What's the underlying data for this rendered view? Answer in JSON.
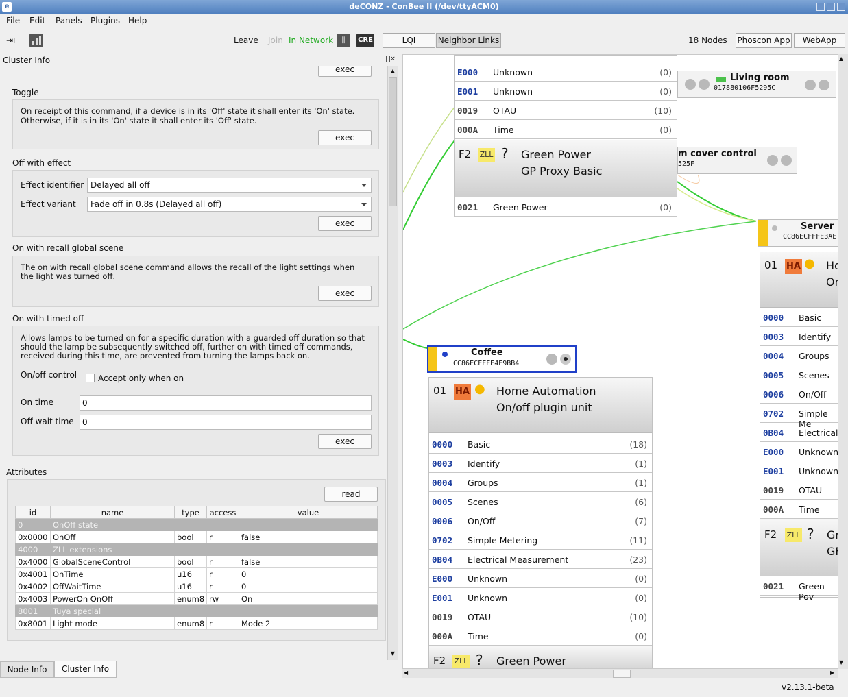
{
  "window": {
    "title": "deCONZ - ConBee II (/dev/ttyACM0)"
  },
  "menu": [
    "File",
    "Edit",
    "Panels",
    "Plugins",
    "Help"
  ],
  "toolbar": {
    "leave": "Leave",
    "join": "Join",
    "status": "In Network",
    "cre": "CRE",
    "lqi": "LQI",
    "neighbor_links": "Neighbor Links",
    "nodes": "18 Nodes",
    "phoscon": "Phoscon App",
    "webapp": "WebApp"
  },
  "panel": {
    "title": "Cluster Info"
  },
  "commands": {
    "exec": "exec",
    "toggle": {
      "title": "Toggle",
      "desc1": "On receipt of this command, if a device is in its 'Off' state it shall enter its 'On' state.",
      "desc2": "Otherwise, if it is in its 'On' state it shall enter its 'Off' state."
    },
    "off_effect": {
      "title": "Off with effect",
      "id_label": "Effect identifier",
      "id_value": "Delayed all off",
      "variant_label": "Effect variant",
      "variant_value": "Fade off in 0.8s (Delayed all off)"
    },
    "recall": {
      "title": "On with recall global scene",
      "desc1": "The on with recall global scene command allows the recall of the light settings when",
      "desc2": "the light was turned off."
    },
    "timed": {
      "title": "On with timed off",
      "desc1": "Allows lamps to be turned on for a specific duration with a guarded off duration so that",
      "desc2": "should the lamp be subsequently switched off, further on with timed off commands,",
      "desc3": "received during this time, are prevented from turning the lamps back on.",
      "onoff_label": "On/off control",
      "accept": "Accept only when on",
      "on_time_label": "On time",
      "on_time": "0",
      "off_wait_label": "Off wait time",
      "off_wait": "0"
    }
  },
  "attributes": {
    "title": "Attributes",
    "read": "read",
    "headers": [
      "id",
      "name",
      "type",
      "access",
      "value"
    ],
    "rows": [
      {
        "group": true,
        "id": "0",
        "name": "OnOff state"
      },
      {
        "id": "0x0000",
        "name": "OnOff",
        "type": "bool",
        "access": "r",
        "value": "false"
      },
      {
        "group": true,
        "id": "4000",
        "name": "ZLL extensions"
      },
      {
        "id": "0x4000",
        "name": "GlobalSceneControl",
        "type": "bool",
        "access": "r",
        "value": "false"
      },
      {
        "id": "0x4001",
        "name": "OnTime",
        "type": "u16",
        "access": "r",
        "value": "0"
      },
      {
        "id": "0x4002",
        "name": "OffWaitTime",
        "type": "u16",
        "access": "r",
        "value": "0"
      },
      {
        "id": "0x4003",
        "name": "PowerOn OnOff",
        "type": "enum8",
        "access": "rw",
        "value": "On"
      },
      {
        "group": true,
        "id": "8001",
        "name": "Tuya special"
      },
      {
        "id": "0x8001",
        "name": "Light mode",
        "type": "enum8",
        "access": "r",
        "value": "Mode 2"
      }
    ]
  },
  "tabs": [
    "Node Info",
    "Cluster Info"
  ],
  "canvas": {
    "top_clusters": [
      {
        "id": "E000",
        "name": "Unknown",
        "count": "(0)"
      },
      {
        "id": "E001",
        "name": "Unknown",
        "count": "(0)"
      },
      {
        "id": "0019",
        "name": "OTAU",
        "count": "(10)"
      },
      {
        "id": "000A",
        "name": "Time",
        "count": "(0)"
      }
    ],
    "gp": {
      "ep": "F2",
      "badge": "ZLL",
      "q": "?",
      "line1": "Green Power",
      "line2": "GP Proxy Basic",
      "cluster_id": "0021",
      "cluster_name": "Green Power",
      "cluster_count": "(0)"
    },
    "living_room": {
      "name": "Living room",
      "mac": "017880106F5295C"
    },
    "cover": {
      "name": "m cover control",
      "mac": "525F"
    },
    "server": {
      "name": "Server",
      "mac": "CC86ECFFFE3AE"
    },
    "coffee": {
      "name": "Coffee",
      "mac": "CC86ECFFFE4E9BB4",
      "ep": "01",
      "badge": "HA",
      "line1": "Home Automation",
      "line2": "On/off plugin unit",
      "clusters": [
        {
          "id": "0000",
          "name": "Basic",
          "count": "(18)"
        },
        {
          "id": "0003",
          "name": "Identify",
          "count": "(1)"
        },
        {
          "id": "0004",
          "name": "Groups",
          "count": "(1)"
        },
        {
          "id": "0005",
          "name": "Scenes",
          "count": "(6)"
        },
        {
          "id": "0006",
          "name": "On/Off",
          "count": "(7)"
        },
        {
          "id": "0702",
          "name": "Simple Metering",
          "count": "(11)"
        },
        {
          "id": "0B04",
          "name": "Electrical Measurement",
          "count": "(23)"
        },
        {
          "id": "E000",
          "name": "Unknown",
          "count": "(0)"
        },
        {
          "id": "E001",
          "name": "Unknown",
          "count": "(0)"
        },
        {
          "id": "0019",
          "name": "OTAU",
          "count": "(10)"
        },
        {
          "id": "000A",
          "name": "Time",
          "count": "(0)"
        }
      ],
      "gp_ep": "F2",
      "gp_badge": "ZLL",
      "gp_q": "?",
      "gp_line1": "Green Power"
    },
    "right": {
      "ep": "01",
      "badge": "HA",
      "line1": "Ho",
      "line2": "Or",
      "clusters": [
        {
          "id": "0000",
          "name": "Basic"
        },
        {
          "id": "0003",
          "name": "Identify"
        },
        {
          "id": "0004",
          "name": "Groups"
        },
        {
          "id": "0005",
          "name": "Scenes"
        },
        {
          "id": "0006",
          "name": "On/Off"
        },
        {
          "id": "0702",
          "name": "Simple Me"
        },
        {
          "id": "0B04",
          "name": "Electrical"
        },
        {
          "id": "E000",
          "name": "Unknown"
        },
        {
          "id": "E001",
          "name": "Unknown"
        },
        {
          "id": "0019",
          "name": "OTAU"
        },
        {
          "id": "000A",
          "name": "Time"
        }
      ],
      "gp_ep": "F2",
      "gp_badge": "ZLL",
      "gp_q": "?",
      "gp_line1": "Gr",
      "gp_line2": "GF",
      "gp_id": "0021",
      "gp_name": "Green Pov"
    }
  },
  "status": {
    "version": "v2.13.1-beta"
  },
  "colors": {
    "accent": "#1e3fa0",
    "ha": "#f07b3b",
    "zll": "#f7e96a",
    "link": "#33cc33",
    "in_network": "#22aa22"
  }
}
